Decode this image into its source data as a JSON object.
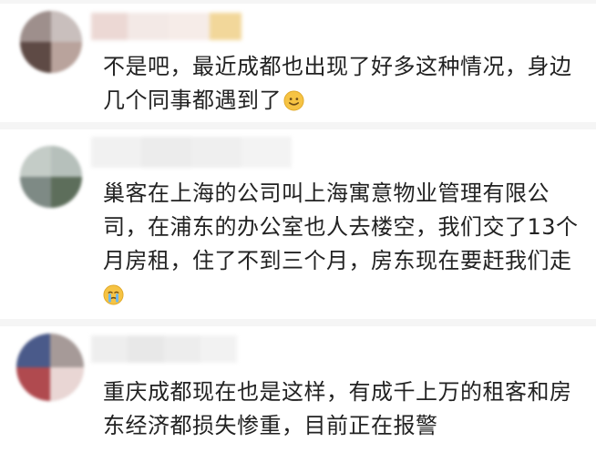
{
  "comments": [
    {
      "text": "不是吧，最近成都也出现了好多这种情况，身边几个同事都遇到了",
      "emoji": "smile-emoji"
    },
    {
      "text": "巢客在上海的公司叫上海寓意物业管理有限公司，在浦东的办公室也人去楼空，我们交了13个月房租，住了不到三个月，房东现在要赶我们走",
      "emoji": "crying-emoji"
    },
    {
      "text": "重庆成都现在也是这样，有成千上万的租客和房东经济都损失惨重，目前正在报警",
      "emoji": ""
    }
  ],
  "colors": {
    "text": "#222222",
    "emoji_yellow": "#f6c343",
    "divider": "#f5f5f5"
  }
}
